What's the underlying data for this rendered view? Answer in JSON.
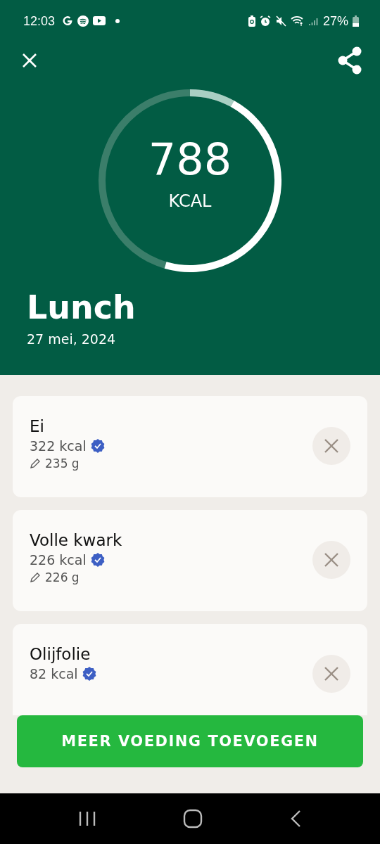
{
  "status_bar": {
    "time": "12:03",
    "battery": "27%"
  },
  "summary": {
    "value": "788",
    "unit": "KCAL"
  },
  "meal": {
    "title": "Lunch",
    "date": "27 mei, 2024"
  },
  "items": [
    {
      "name": "Ei",
      "kcal": "322 kcal",
      "verified": true,
      "weight": "235 g"
    },
    {
      "name": "Volle kwark",
      "kcal": "226 kcal",
      "verified": true,
      "weight": "226 g"
    },
    {
      "name": "Olijfolie",
      "kcal": "82 kcal",
      "verified": true
    }
  ],
  "add_button": "MEER VOEDING TOEVOEGEN"
}
